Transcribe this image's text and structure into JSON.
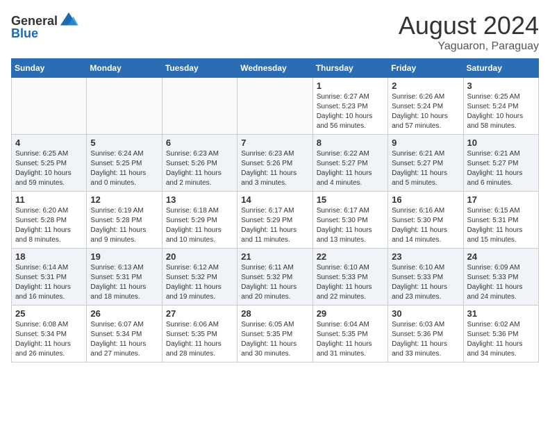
{
  "header": {
    "logo_general": "General",
    "logo_blue": "Blue",
    "month_year": "August 2024",
    "location": "Yaguaron, Paraguay"
  },
  "weekdays": [
    "Sunday",
    "Monday",
    "Tuesday",
    "Wednesday",
    "Thursday",
    "Friday",
    "Saturday"
  ],
  "weeks": [
    [
      {
        "day": "",
        "info": ""
      },
      {
        "day": "",
        "info": ""
      },
      {
        "day": "",
        "info": ""
      },
      {
        "day": "",
        "info": ""
      },
      {
        "day": "1",
        "info": "Sunrise: 6:27 AM\nSunset: 5:23 PM\nDaylight: 10 hours and 56 minutes."
      },
      {
        "day": "2",
        "info": "Sunrise: 6:26 AM\nSunset: 5:24 PM\nDaylight: 10 hours and 57 minutes."
      },
      {
        "day": "3",
        "info": "Sunrise: 6:25 AM\nSunset: 5:24 PM\nDaylight: 10 hours and 58 minutes."
      }
    ],
    [
      {
        "day": "4",
        "info": "Sunrise: 6:25 AM\nSunset: 5:25 PM\nDaylight: 10 hours and 59 minutes."
      },
      {
        "day": "5",
        "info": "Sunrise: 6:24 AM\nSunset: 5:25 PM\nDaylight: 11 hours and 0 minutes."
      },
      {
        "day": "6",
        "info": "Sunrise: 6:23 AM\nSunset: 5:26 PM\nDaylight: 11 hours and 2 minutes."
      },
      {
        "day": "7",
        "info": "Sunrise: 6:23 AM\nSunset: 5:26 PM\nDaylight: 11 hours and 3 minutes."
      },
      {
        "day": "8",
        "info": "Sunrise: 6:22 AM\nSunset: 5:27 PM\nDaylight: 11 hours and 4 minutes."
      },
      {
        "day": "9",
        "info": "Sunrise: 6:21 AM\nSunset: 5:27 PM\nDaylight: 11 hours and 5 minutes."
      },
      {
        "day": "10",
        "info": "Sunrise: 6:21 AM\nSunset: 5:27 PM\nDaylight: 11 hours and 6 minutes."
      }
    ],
    [
      {
        "day": "11",
        "info": "Sunrise: 6:20 AM\nSunset: 5:28 PM\nDaylight: 11 hours and 8 minutes."
      },
      {
        "day": "12",
        "info": "Sunrise: 6:19 AM\nSunset: 5:28 PM\nDaylight: 11 hours and 9 minutes."
      },
      {
        "day": "13",
        "info": "Sunrise: 6:18 AM\nSunset: 5:29 PM\nDaylight: 11 hours and 10 minutes."
      },
      {
        "day": "14",
        "info": "Sunrise: 6:17 AM\nSunset: 5:29 PM\nDaylight: 11 hours and 11 minutes."
      },
      {
        "day": "15",
        "info": "Sunrise: 6:17 AM\nSunset: 5:30 PM\nDaylight: 11 hours and 13 minutes."
      },
      {
        "day": "16",
        "info": "Sunrise: 6:16 AM\nSunset: 5:30 PM\nDaylight: 11 hours and 14 minutes."
      },
      {
        "day": "17",
        "info": "Sunrise: 6:15 AM\nSunset: 5:31 PM\nDaylight: 11 hours and 15 minutes."
      }
    ],
    [
      {
        "day": "18",
        "info": "Sunrise: 6:14 AM\nSunset: 5:31 PM\nDaylight: 11 hours and 16 minutes."
      },
      {
        "day": "19",
        "info": "Sunrise: 6:13 AM\nSunset: 5:31 PM\nDaylight: 11 hours and 18 minutes."
      },
      {
        "day": "20",
        "info": "Sunrise: 6:12 AM\nSunset: 5:32 PM\nDaylight: 11 hours and 19 minutes."
      },
      {
        "day": "21",
        "info": "Sunrise: 6:11 AM\nSunset: 5:32 PM\nDaylight: 11 hours and 20 minutes."
      },
      {
        "day": "22",
        "info": "Sunrise: 6:10 AM\nSunset: 5:33 PM\nDaylight: 11 hours and 22 minutes."
      },
      {
        "day": "23",
        "info": "Sunrise: 6:10 AM\nSunset: 5:33 PM\nDaylight: 11 hours and 23 minutes."
      },
      {
        "day": "24",
        "info": "Sunrise: 6:09 AM\nSunset: 5:33 PM\nDaylight: 11 hours and 24 minutes."
      }
    ],
    [
      {
        "day": "25",
        "info": "Sunrise: 6:08 AM\nSunset: 5:34 PM\nDaylight: 11 hours and 26 minutes."
      },
      {
        "day": "26",
        "info": "Sunrise: 6:07 AM\nSunset: 5:34 PM\nDaylight: 11 hours and 27 minutes."
      },
      {
        "day": "27",
        "info": "Sunrise: 6:06 AM\nSunset: 5:35 PM\nDaylight: 11 hours and 28 minutes."
      },
      {
        "day": "28",
        "info": "Sunrise: 6:05 AM\nSunset: 5:35 PM\nDaylight: 11 hours and 30 minutes."
      },
      {
        "day": "29",
        "info": "Sunrise: 6:04 AM\nSunset: 5:35 PM\nDaylight: 11 hours and 31 minutes."
      },
      {
        "day": "30",
        "info": "Sunrise: 6:03 AM\nSunset: 5:36 PM\nDaylight: 11 hours and 33 minutes."
      },
      {
        "day": "31",
        "info": "Sunrise: 6:02 AM\nSunset: 5:36 PM\nDaylight: 11 hours and 34 minutes."
      }
    ]
  ]
}
